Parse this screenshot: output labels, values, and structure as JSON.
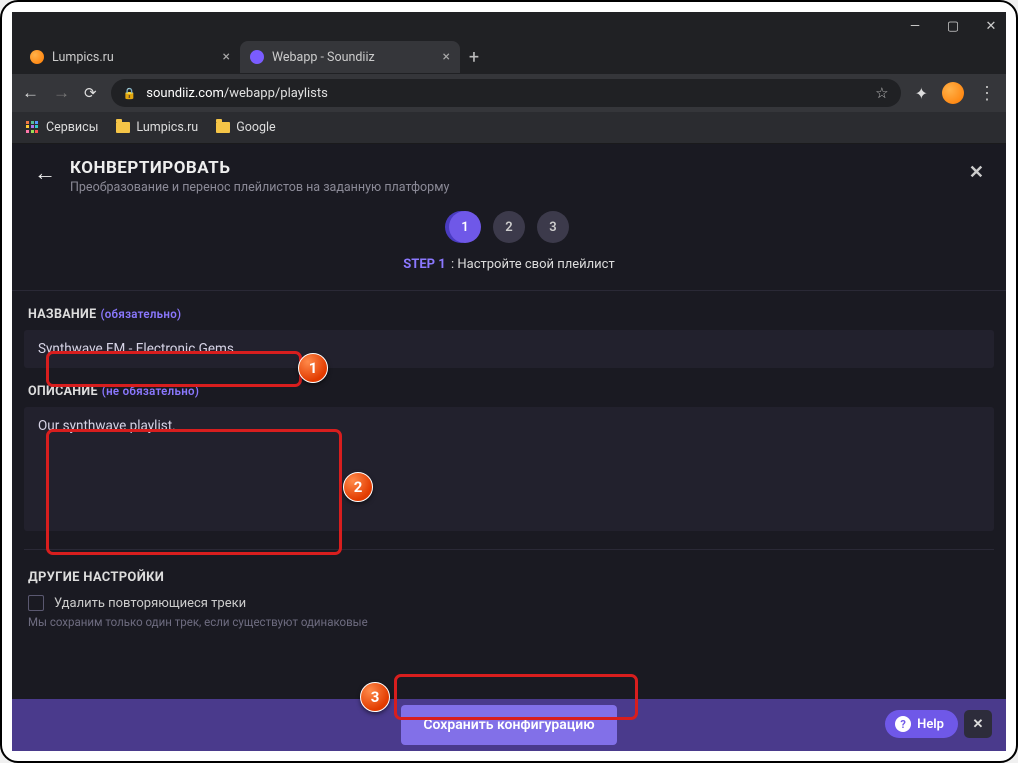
{
  "window": {
    "tabs": [
      {
        "title": "Lumpics.ru",
        "active": false
      },
      {
        "title": "Webapp - Soundiiz",
        "active": true
      }
    ],
    "url_host": "soundiiz.com",
    "url_path": "/webapp/playlists"
  },
  "bookmarks": {
    "services": "Сервисы",
    "b1": "Lumpics.ru",
    "b2": "Google"
  },
  "page": {
    "title": "КОНВЕРТИРОВАТЬ",
    "subtitle": "Преобразование и перенос плейлистов на заданную платформу",
    "steps": [
      "1",
      "2",
      "3"
    ],
    "step_prefix": "STEP 1",
    "step_text": " : Настройте свой плейлист",
    "name_label": "НАЗВАНИЕ",
    "name_req": "(обязательно)",
    "name_value": "Synthwave FM - Electronic Gems",
    "desc_label": "ОПИСАНИЕ",
    "desc_req": "(не обязательно)",
    "desc_value": "Our synthwave playlist.",
    "other_label": "ДРУГИЕ НАСТРОЙКИ",
    "dup_label": "Удалить повторяющиеся треки",
    "dup_hint": "Мы сохраним только один трек, если существуют одинаковые",
    "save_btn": "Сохранить конфигурацию",
    "help": "Help"
  },
  "callouts": {
    "c1": "1",
    "c2": "2",
    "c3": "3"
  }
}
